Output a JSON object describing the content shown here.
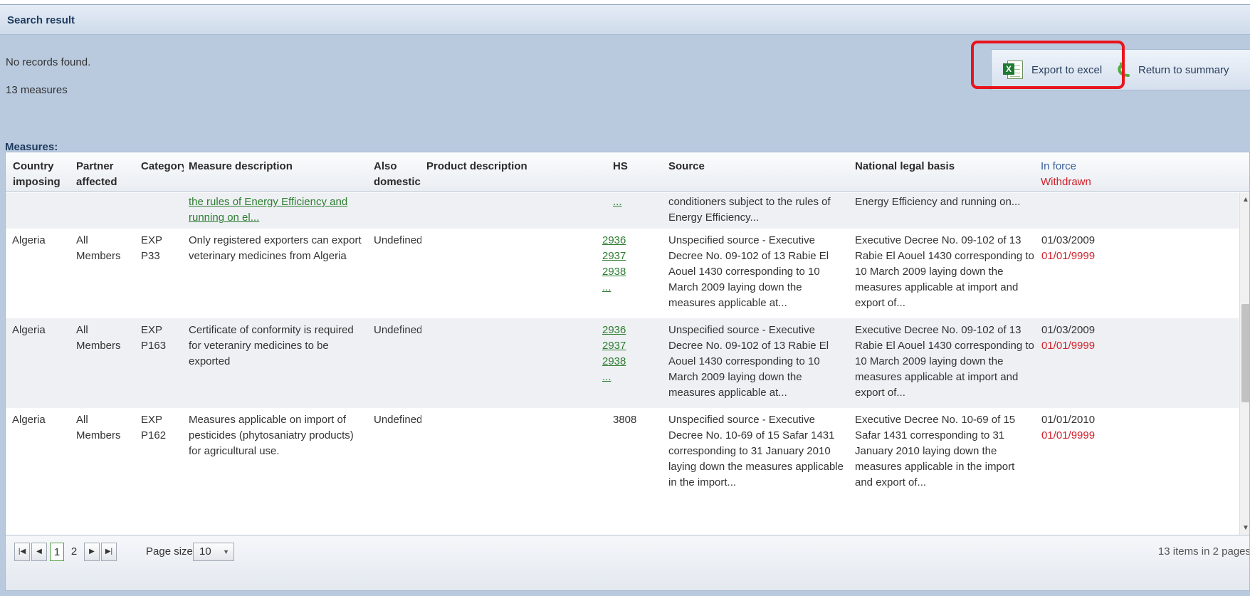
{
  "panel": {
    "title": "Search result"
  },
  "status": {
    "no_records": "No records found.",
    "measures_count": "13 measures"
  },
  "toolbar": {
    "export_label": "Export to excel",
    "return_label": "Return to summary"
  },
  "section": {
    "measures_label": "Measures:"
  },
  "grid": {
    "columns": {
      "country": [
        "Country",
        "imposing"
      ],
      "partner": [
        "Partner",
        "affected"
      ],
      "category": "Category",
      "measure": "Measure description",
      "also": [
        "Also",
        "domestic"
      ],
      "product": "Product description",
      "hs": "HS",
      "source": "Source",
      "legal": "National legal basis",
      "in_force": "In force",
      "withdrawn": "Withdrawn"
    },
    "partial_row": {
      "measure": [
        "the rules of Energy Efficiency and",
        "running on el..."
      ],
      "hs": "...",
      "source": [
        "conditioners subject to the rules of",
        "Energy Efficiency..."
      ],
      "legal": "Energy Efficiency and running on..."
    },
    "rows": [
      {
        "country": "Algeria",
        "partner": [
          "All",
          "Members"
        ],
        "category": [
          "EXP",
          "P33"
        ],
        "measure": [
          "Only registered exporters can export",
          "veterinary medicines from Algeria"
        ],
        "also": "Undefined",
        "hs": [
          "2936",
          "2937",
          "2938",
          "..."
        ],
        "source": [
          "Unspecified source - Executive",
          "Decree No. 09-102 of 13 Rabie El",
          "Aouel 1430 corresponding to 10",
          "March 2009 laying down the",
          "measures applicable at..."
        ],
        "legal": [
          "Executive Decree No. 09-102 of 13",
          "Rabie El Aouel 1430 corresponding to",
          "10 March 2009 laying down the",
          "measures applicable at import and",
          "export of..."
        ],
        "in_force": "01/03/2009",
        "withdrawn": "01/01/9999"
      },
      {
        "country": "Algeria",
        "partner": [
          "All",
          "Members"
        ],
        "category": [
          "EXP",
          "P163"
        ],
        "measure": [
          "Certificate of conformity is required",
          "for veteraniry medicines to be",
          "exported"
        ],
        "also": "Undefined",
        "hs": [
          "2936",
          "2937",
          "2938",
          "..."
        ],
        "source": [
          "Unspecified source - Executive",
          "Decree No. 09-102 of 13 Rabie El",
          "Aouel 1430 corresponding to 10",
          "March 2009 laying down the",
          "measures applicable at..."
        ],
        "legal": [
          "Executive Decree No. 09-102 of 13",
          "Rabie El Aouel 1430 corresponding to",
          "10 March 2009 laying down the",
          "measures applicable at import and",
          "export of..."
        ],
        "in_force": "01/03/2009",
        "withdrawn": "01/01/9999"
      },
      {
        "country": "Algeria",
        "partner": [
          "All",
          "Members"
        ],
        "category": [
          "EXP",
          "P162"
        ],
        "measure": [
          "Measures applicable on import of",
          "pesticides (phytosaniatry products)",
          "for agricultural use."
        ],
        "also": "Undefined",
        "hs": [
          "3808"
        ],
        "source": [
          "Unspecified source - Executive",
          "Decree No. 10-69 of 15 Safar 1431",
          "corresponding to 31 January 2010",
          "laying down the measures applicable",
          "in the import..."
        ],
        "legal": [
          "Executive Decree No. 10-69 of 15",
          "Safar 1431 corresponding to 31",
          "January 2010 laying down the",
          "measures applicable in the import",
          "and export of..."
        ],
        "in_force": "01/01/2010",
        "withdrawn": "01/01/9999"
      }
    ]
  },
  "pager": {
    "pages": [
      "1",
      "2"
    ],
    "current_page": "1",
    "page_size_label": "Page size:",
    "page_size_value": "10",
    "items_info": "13 items in 2 pages"
  },
  "icons": {
    "first": "first-page-icon",
    "prev": "prev-page-icon",
    "next": "next-page-icon",
    "last": "last-page-icon",
    "excel": "excel-icon",
    "return": "return-icon"
  },
  "colors": {
    "link": "#2e7d32",
    "withdrawn": "#d0202a",
    "highlight": "#e8141c",
    "panel": "#b9cadf"
  }
}
